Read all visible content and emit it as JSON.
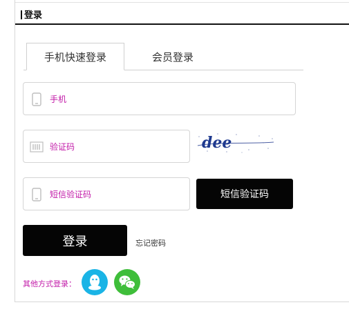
{
  "header": {
    "title": "登录"
  },
  "tabs": [
    {
      "label": "手机快速登录",
      "active": true
    },
    {
      "label": "会员登录",
      "active": false
    }
  ],
  "form": {
    "phone_placeholder": "手机",
    "code_placeholder": "验证码",
    "sms_code_placeholder": "短信验证码",
    "captcha_text": "dee",
    "sms_button_label": "短信验证码",
    "login_button_label": "登录",
    "forgot_password_label": "忘记密码"
  },
  "other_login": {
    "label": "其他方式登录：",
    "icons": [
      "qq-icon",
      "wechat-icon"
    ]
  },
  "colors": {
    "accent_text": "#c21aa8",
    "button_bg": "#050505",
    "qq": "#1ab4e6",
    "wechat": "#3fbe3a"
  }
}
